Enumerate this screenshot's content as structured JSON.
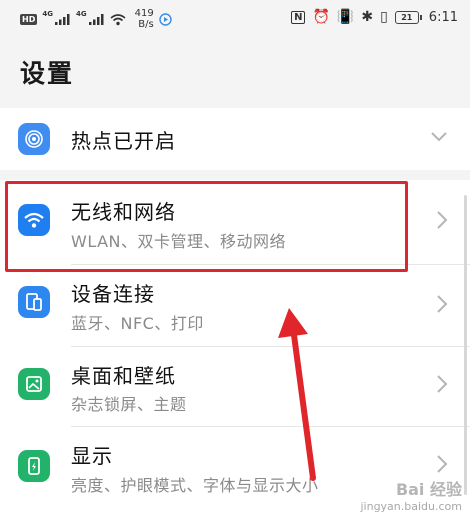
{
  "status_bar": {
    "hd": "HD",
    "sim1": "4G",
    "sim2": "4G",
    "speed_value": "419",
    "speed_unit": "B/s",
    "battery": "21",
    "time": "6:11"
  },
  "page_title": "设置",
  "rows": [
    {
      "title": "热点已开启",
      "subtitle": "",
      "icon": "hotspot-icon",
      "accent": "#3f8df0"
    },
    {
      "title": "无线和网络",
      "subtitle": "WLAN、双卡管理、移动网络",
      "icon": "wifi-icon",
      "accent": "#1f7ff0"
    },
    {
      "title": "设备连接",
      "subtitle": "蓝牙、NFC、打印",
      "icon": "device-connect-icon",
      "accent": "#2e86ef"
    },
    {
      "title": "桌面和壁纸",
      "subtitle": "杂志锁屏、主题",
      "icon": "wallpaper-icon",
      "accent": "#22b26a"
    },
    {
      "title": "显示",
      "subtitle": "亮度、护眼模式、字体与显示大小",
      "icon": "display-icon",
      "accent": "#22b26a"
    }
  ],
  "annotation": {
    "highlight_color": "#d9282f",
    "arrow_color": "#e0252b"
  },
  "watermark": {
    "line1": "Bai 经验",
    "line2": "jingyan.baidu.com"
  }
}
